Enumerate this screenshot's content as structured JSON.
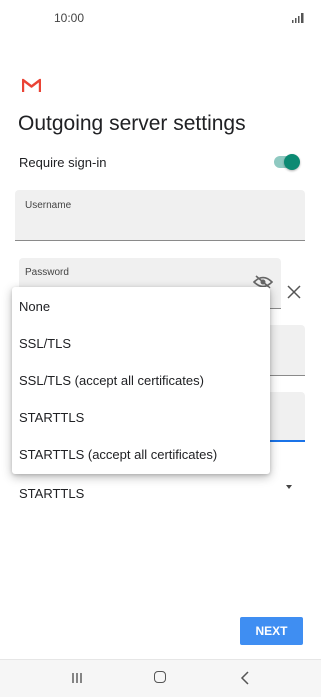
{
  "status_bar": {
    "time": "10:00"
  },
  "header": {
    "title": "Outgoing server settings"
  },
  "require_signin": {
    "label": "Require sign-in",
    "enabled": true
  },
  "username": {
    "label": "Username",
    "value": ""
  },
  "password": {
    "label": "Password",
    "value": ""
  },
  "security_type": {
    "selected": "STARTTLS",
    "options": [
      "None",
      "SSL/TLS",
      "SSL/TLS (accept all certificates)",
      "STARTTLS",
      "STARTTLS (accept all certificates)"
    ]
  },
  "actions": {
    "next_label": "NEXT"
  },
  "colors": {
    "accent": "#3f8ef2",
    "toggle": "#0c8a73",
    "gmail_red": "#ea4335"
  },
  "icons": [
    "signal-icon",
    "gmail-logo",
    "eye-off-icon",
    "close-icon",
    "recent-apps-icon",
    "home-icon",
    "back-icon"
  ]
}
